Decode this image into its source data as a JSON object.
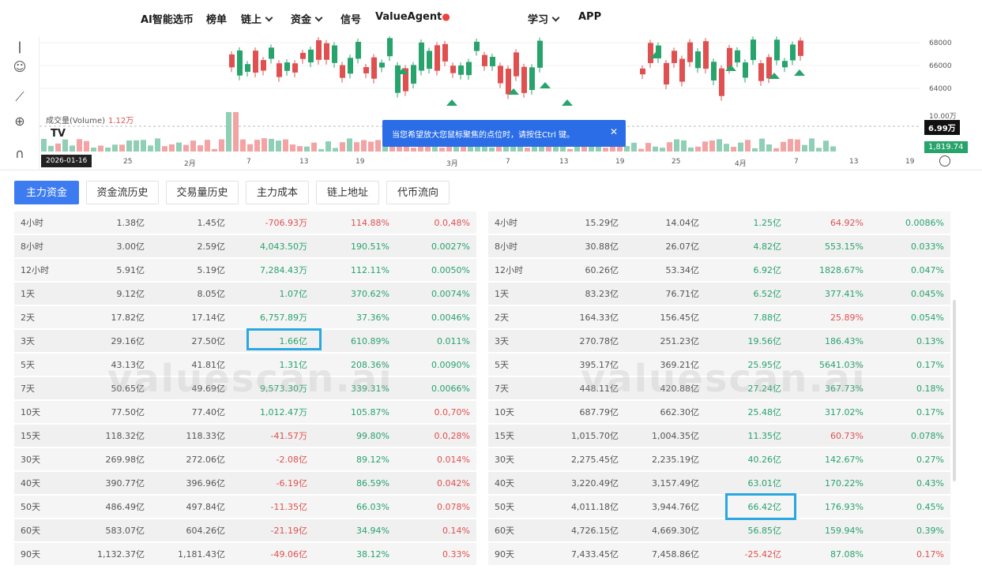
{
  "nav": {
    "items": [
      "AI智能选币",
      "榜单",
      "链上",
      "资金",
      "信号",
      "ValueAgent",
      "学习",
      "APP"
    ]
  },
  "chart": {
    "y_ticks": [
      "68000",
      "66000",
      "64000",
      "10.00万"
    ],
    "volume_label": "成交量(Volume)",
    "volume_value": "1.12万",
    "price_badge": "6.99万",
    "green_badge": "1,819.74",
    "date_badge": "2026-01-16",
    "x_ticks": [
      "25",
      "2月",
      "7",
      "13",
      "19",
      "3月",
      "7",
      "13",
      "19",
      "25",
      "4月",
      "7",
      "13",
      "19"
    ],
    "tooltip": "当您希望放大您鼠标聚焦的点位时，请按住Ctrl 键。",
    "tv_logo": "TV"
  },
  "tabs": [
    "主力资金",
    "资金流历史",
    "交易量历史",
    "主力成本",
    "链上地址",
    "代币流向"
  ],
  "watermark": "valuescan.ai",
  "left_table": [
    [
      "4小时",
      "1.38亿",
      "1.45亿",
      "-706.93万",
      "114.88%",
      "0.0,48%"
    ],
    [
      "8小时",
      "3.00亿",
      "2.59亿",
      "4,043.50万",
      "190.51%",
      "0.0027%"
    ],
    [
      "12小时",
      "5.91亿",
      "5.19亿",
      "7,284.43万",
      "112.11%",
      "0.0050%"
    ],
    [
      "1天",
      "9.12亿",
      "8.05亿",
      "1.07亿",
      "370.62%",
      "0.0074%"
    ],
    [
      "2天",
      "17.82亿",
      "17.14亿",
      "6,757.89万",
      "37.36%",
      "0.0046%"
    ],
    [
      "3天",
      "29.16亿",
      "27.50亿",
      "1.66亿",
      "610.89%",
      "0.011%"
    ],
    [
      "5天",
      "43.13亿",
      "41.81亿",
      "1.31亿",
      "208.36%",
      "0.0090%"
    ],
    [
      "7天",
      "50.65亿",
      "49.69亿",
      "9,573.30万",
      "339.31%",
      "0.0066%"
    ],
    [
      "10天",
      "77.50亿",
      "77.40亿",
      "1,012.47万",
      "105.87%",
      "0.0,70%"
    ],
    [
      "15天",
      "118.32亿",
      "118.33亿",
      "-41.57万",
      "99.80%",
      "0.0,28%"
    ],
    [
      "30天",
      "269.98亿",
      "272.06亿",
      "-2.08亿",
      "89.12%",
      "0.014%"
    ],
    [
      "40天",
      "390.77亿",
      "396.96亿",
      "-6.19亿",
      "86.59%",
      "0.042%"
    ],
    [
      "50天",
      "486.49亿",
      "497.84亿",
      "-11.35亿",
      "66.03%",
      "0.078%"
    ],
    [
      "60天",
      "583.07亿",
      "604.26亿",
      "-21.19亿",
      "34.94%",
      "0.14%"
    ],
    [
      "90天",
      "1,132.37亿",
      "1,181.43亿",
      "-49.06亿",
      "38.12%",
      "0.33%"
    ]
  ],
  "left_colors": [
    [
      "neg",
      "neg",
      "neg"
    ],
    [
      "pos",
      "pos",
      "pos"
    ],
    [
      "pos",
      "pos",
      "pos"
    ],
    [
      "pos",
      "pos",
      "pos"
    ],
    [
      "pos",
      "pos",
      "pos"
    ],
    [
      "pos",
      "pos",
      "pos"
    ],
    [
      "pos",
      "pos",
      "pos"
    ],
    [
      "pos",
      "pos",
      "pos"
    ],
    [
      "pos",
      "pos",
      "neg"
    ],
    [
      "neg",
      "pos",
      "neg"
    ],
    [
      "neg",
      "pos",
      "neg"
    ],
    [
      "neg",
      "pos",
      "neg"
    ],
    [
      "neg",
      "pos",
      "neg"
    ],
    [
      "neg",
      "pos",
      "neg"
    ],
    [
      "neg",
      "pos",
      "neg"
    ]
  ],
  "right_table": [
    [
      "4小时",
      "15.29亿",
      "14.04亿",
      "1.25亿",
      "64.92%",
      "0.0086%"
    ],
    [
      "8小时",
      "30.88亿",
      "26.07亿",
      "4.82亿",
      "553.15%",
      "0.033%"
    ],
    [
      "12小时",
      "60.26亿",
      "53.34亿",
      "6.92亿",
      "1828.67%",
      "0.047%"
    ],
    [
      "1天",
      "83.23亿",
      "76.71亿",
      "6.52亿",
      "377.41%",
      "0.045%"
    ],
    [
      "2天",
      "164.33亿",
      "156.45亿",
      "7.88亿",
      "25.89%",
      "0.054%"
    ],
    [
      "3天",
      "270.78亿",
      "251.23亿",
      "19.56亿",
      "186.43%",
      "0.13%"
    ],
    [
      "5天",
      "395.17亿",
      "369.21亿",
      "25.95亿",
      "5641.03%",
      "0.17%"
    ],
    [
      "7天",
      "448.11亿",
      "420.88亿",
      "27.24亿",
      "367.73%",
      "0.18%"
    ],
    [
      "10天",
      "687.79亿",
      "662.30亿",
      "25.48亿",
      "317.02%",
      "0.17%"
    ],
    [
      "15天",
      "1,015.70亿",
      "1,004.35亿",
      "11.35亿",
      "60.73%",
      "0.078%"
    ],
    [
      "30天",
      "2,275.45亿",
      "2,235.19亿",
      "40.26亿",
      "142.67%",
      "0.27%"
    ],
    [
      "40天",
      "3,220.49亿",
      "3,157.49亿",
      "63.01亿",
      "170.22%",
      "0.43%"
    ],
    [
      "50天",
      "4,011.18亿",
      "3,944.76亿",
      "66.42亿",
      "176.93%",
      "0.45%"
    ],
    [
      "60天",
      "4,726.15亿",
      "4,669.30亿",
      "56.85亿",
      "159.94%",
      "0.39%"
    ],
    [
      "90天",
      "7,433.45亿",
      "7,458.86亿",
      "-25.42亿",
      "87.08%",
      "0.17%"
    ]
  ],
  "right_colors": [
    [
      "pos",
      "neg",
      "pos"
    ],
    [
      "pos",
      "pos",
      "pos"
    ],
    [
      "pos",
      "pos",
      "pos"
    ],
    [
      "pos",
      "pos",
      "pos"
    ],
    [
      "pos",
      "neg",
      "pos"
    ],
    [
      "pos",
      "pos",
      "pos"
    ],
    [
      "pos",
      "pos",
      "pos"
    ],
    [
      "pos",
      "pos",
      "pos"
    ],
    [
      "pos",
      "pos",
      "pos"
    ],
    [
      "pos",
      "neg",
      "pos"
    ],
    [
      "pos",
      "pos",
      "pos"
    ],
    [
      "pos",
      "pos",
      "pos"
    ],
    [
      "pos",
      "pos",
      "pos"
    ],
    [
      "pos",
      "pos",
      "pos"
    ],
    [
      "neg",
      "pos",
      "neg"
    ]
  ],
  "colors": {
    "up": "#27a36c",
    "down": "#e05050",
    "accent": "#3d7cf0",
    "highlight": "#29a8e0"
  }
}
